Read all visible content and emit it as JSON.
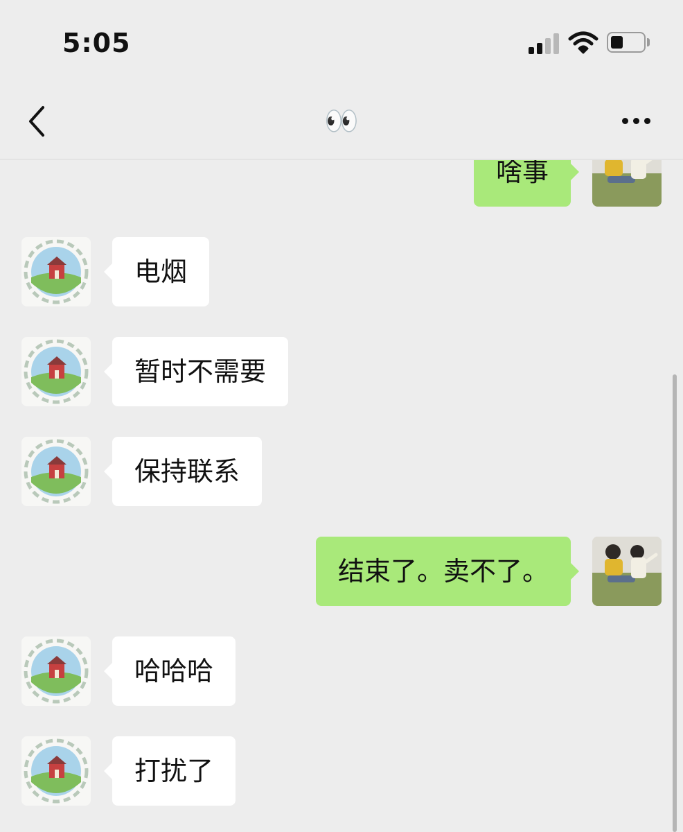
{
  "status_bar": {
    "time": "5:05",
    "signal_icon": "cellular-signal-icon",
    "wifi_icon": "wifi-icon",
    "battery_icon": "battery-icon",
    "battery_level": 0.35
  },
  "nav": {
    "back_icon": "chevron-left-icon",
    "title": "👀",
    "more_icon": "more-dots-icon"
  },
  "messages": [
    {
      "sender": "self",
      "text": "啥事"
    },
    {
      "sender": "other",
      "text": "电烟"
    },
    {
      "sender": "other",
      "text": "暂时不需要"
    },
    {
      "sender": "other",
      "text": "保持联系"
    },
    {
      "sender": "self",
      "text": "结束了。卖不了。"
    },
    {
      "sender": "other",
      "text": "哈哈哈"
    },
    {
      "sender": "other",
      "text": "打扰了"
    }
  ],
  "colors": {
    "background": "#ededed",
    "self_bubble": "#a9e97a",
    "other_bubble": "#ffffff"
  }
}
